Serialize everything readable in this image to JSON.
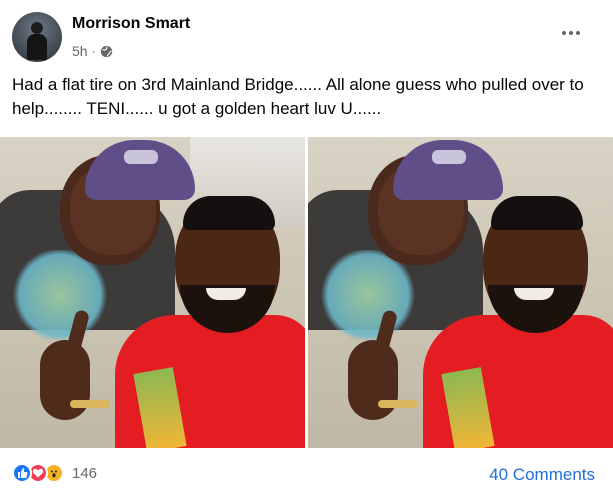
{
  "post": {
    "author": "Morrison Smart",
    "time": "5h",
    "separator": "·",
    "privacy_icon": "globe-icon",
    "text": "Had a flat tire on 3rd Mainland Bridge...... All alone guess who pulled over to help........ TENI...... u got a golden heart luv U......",
    "photo_count": 2
  },
  "footer": {
    "reactions": [
      "like-icon",
      "love-icon",
      "wow-icon"
    ],
    "reaction_count": "146",
    "comments_label": "40 Comments"
  },
  "colors": {
    "like": "#1877f2",
    "love": "#f33e58",
    "wow": "#f7b125",
    "link": "#216fdb",
    "secondary_text": "#65676b"
  }
}
